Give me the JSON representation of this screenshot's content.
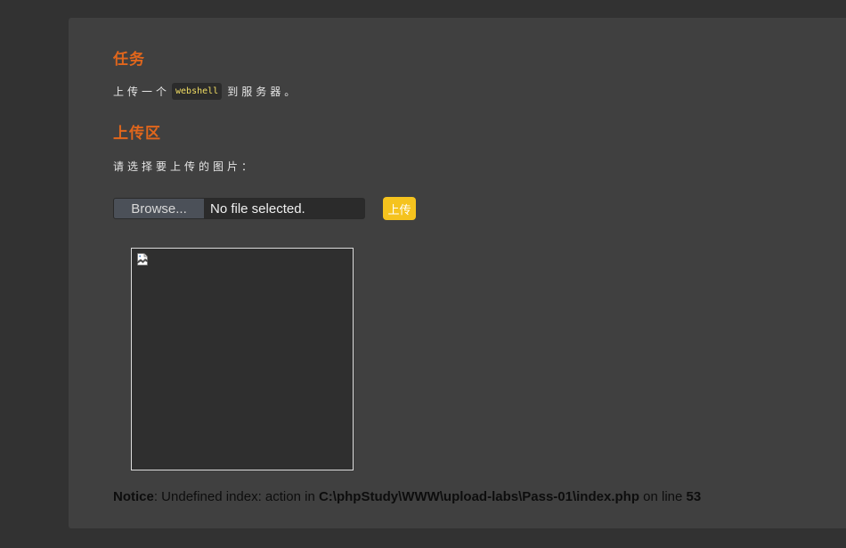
{
  "task": {
    "heading": "任务",
    "text_before": "上传一个",
    "code": "webshell",
    "text_after": "到服务器。"
  },
  "upload": {
    "heading": "上传区",
    "choose_label": "请选择要上传的图片：",
    "browse_label": "Browse...",
    "file_status": "No file selected.",
    "submit_label": "上传"
  },
  "preview": {
    "icon": "broken-image-icon"
  },
  "notice": {
    "label": "Notice",
    "message": ": Undefined index: action in ",
    "path": "C:\\phpStudy\\WWW\\upload-labs\\Pass-01\\index.php",
    "on_line": " on line ",
    "line_number": "53"
  }
}
